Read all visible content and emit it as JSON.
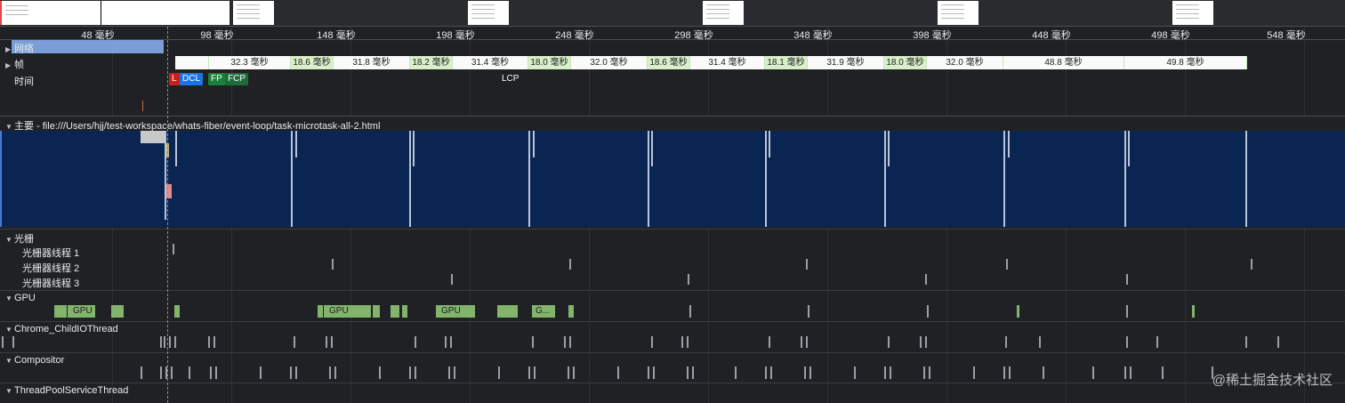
{
  "ruler": {
    "ticks": [
      "48 毫秒",
      "98 毫秒",
      "148 毫秒",
      "198 毫秒",
      "248 毫秒",
      "298 毫秒",
      "348 毫秒",
      "398 毫秒",
      "448 毫秒",
      "498 毫秒",
      "548 毫秒"
    ]
  },
  "tracks": {
    "network": "网络",
    "frames": "帧",
    "timings": "时间",
    "main": "主要 - file:///Users/hjj/test-workspace/whats-fiber/event-loop/task-microtask-all-2.html",
    "raster": "光栅",
    "raster_threads": [
      "光栅器线程 1",
      "光栅器线程 2",
      "光栅器线程 3"
    ],
    "gpu": "GPU",
    "child_io": "Chrome_ChildIOThread",
    "compositor": "Compositor",
    "threadpool": "ThreadPoolServiceThread"
  },
  "frames": [
    "32.3 毫秒",
    "18.6 毫秒",
    "31.8 毫秒",
    "18.2 毫秒",
    "31.4 毫秒",
    "18.0 毫秒",
    "32.0 毫秒",
    "18.6 毫秒",
    "31.4 毫秒",
    "18.1 毫秒",
    "31.9 毫秒",
    "18.0 毫秒",
    "32.0 毫秒",
    "48.8 毫秒",
    "49.8 毫秒"
  ],
  "markers": {
    "l": "L",
    "dcl": "DCL",
    "fp": "FP",
    "fcp": "FCP",
    "lcp": "LCP"
  },
  "gpu_bars": [
    "GPU",
    "GPU",
    "GPU",
    "G..."
  ],
  "colors": {
    "l": "#c5221f",
    "dcl": "#1a73e8",
    "fp": "#188038",
    "fcp": "#1e6b3a",
    "lcp": "#202124",
    "main_bg": "#0b2553",
    "gpu": "#82b46b"
  },
  "watermark": "@稀土掘金技术社区"
}
